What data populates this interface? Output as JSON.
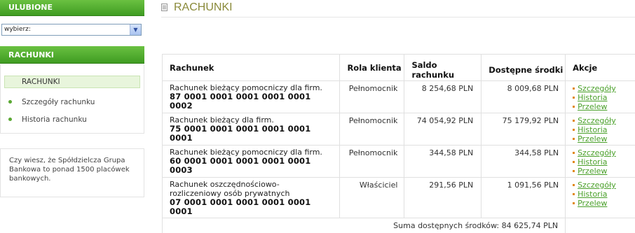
{
  "sidebar": {
    "favorites_header": "ULUBIONE",
    "select_value": "wybierz:",
    "accounts_header": "RACHUNKI",
    "menu": {
      "active": "RACHUNKI",
      "details": "Szczegóły rachunku",
      "history": "Historia rachunku"
    },
    "info_text": "Czy wiesz, że Spółdzielcza Grupa Bankowa to ponad 1500 placówek bankowych."
  },
  "main": {
    "title": "RACHUNKI",
    "columns": {
      "account": "Rachunek",
      "role": "Rola klienta",
      "balance": "Saldo rachunku",
      "available": "Dostępne środki",
      "actions": "Akcje"
    },
    "rows": [
      {
        "name": "Rachunek bieżący pomocniczy dla firm.",
        "number": "87 0001 0001 0001 0001 0001 0002",
        "role": "Pełnomocnik",
        "balance": "8 254,68 PLN",
        "available": "8 009,68 PLN"
      },
      {
        "name": "Rachunek bieżący dla firm.",
        "number": "75 0001 0001 0001 0001 0001 0001",
        "role": "Pełnomocnik",
        "balance": "74 054,92 PLN",
        "available": "75 179,92 PLN"
      },
      {
        "name": "Rachunek bieżący pomocniczy dla firm.",
        "number": "60 0001 0001 0001 0001 0001 0003",
        "role": "Pełnomocnik",
        "balance": "344,58 PLN",
        "available": "344,58 PLN"
      },
      {
        "name_line1": "Rachunek oszczędnościowo-",
        "name_line2": "rozliczeniowy osób prywatnych",
        "number": "07 0001 0001 0001 0001 0001 0001",
        "role": "Właściciel",
        "balance": "291,56 PLN",
        "available": "1 091,56 PLN"
      }
    ],
    "action_labels": {
      "details": "Szczegóły",
      "history": "Historia",
      "transfer": "Przelew"
    },
    "total": "Suma dostępnych środków: 84 625,74 PLN"
  }
}
